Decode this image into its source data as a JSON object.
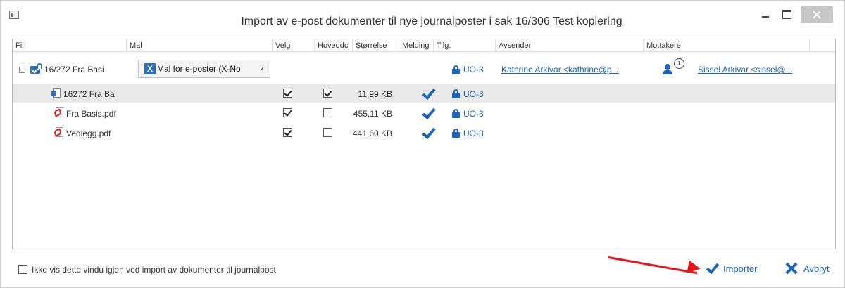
{
  "window": {
    "title": "Import av e-post dokumenter til nye journalposter i sak 16/306 Test kopiering"
  },
  "grid": {
    "columns": [
      "Fil",
      "Mal",
      "Velg",
      "Hoveddc",
      "Størrelse",
      "Melding",
      "Tilg.",
      "Avsender",
      "Mottakere"
    ],
    "parent": {
      "file": "16/272 Fra Basi",
      "template": "Mal for e-poster (X-No",
      "access": "UO-3",
      "sender": "Kathrine Arkivar <kathrine@p...",
      "recipient_info": "i",
      "recipient": "Sissel Arkivar <sissel@..."
    },
    "rows": [
      {
        "file": "16272 Fra Ba",
        "selected": true,
        "main": true,
        "size": "11,99 KB",
        "access": "UO-3",
        "icon": "email-document-icon"
      },
      {
        "file": "Fra Basis.pdf",
        "selected": true,
        "main": false,
        "size": "455,11 KB",
        "access": "UO-3",
        "icon": "pdf-icon"
      },
      {
        "file": "Vedlegg.pdf",
        "selected": true,
        "main": false,
        "size": "441,60 KB",
        "access": "UO-3",
        "icon": "pdf-icon"
      }
    ]
  },
  "footer": {
    "dont_show_label": "Ikke vis dette vindu igjen ved import av dokumenter til journalpost",
    "import_label": "Importer",
    "cancel_label": "Avbryt"
  },
  "colors": {
    "accent": "#1c65b8",
    "annotation_arrow": "#e4181c",
    "selected_row": "#e9e9e9"
  }
}
